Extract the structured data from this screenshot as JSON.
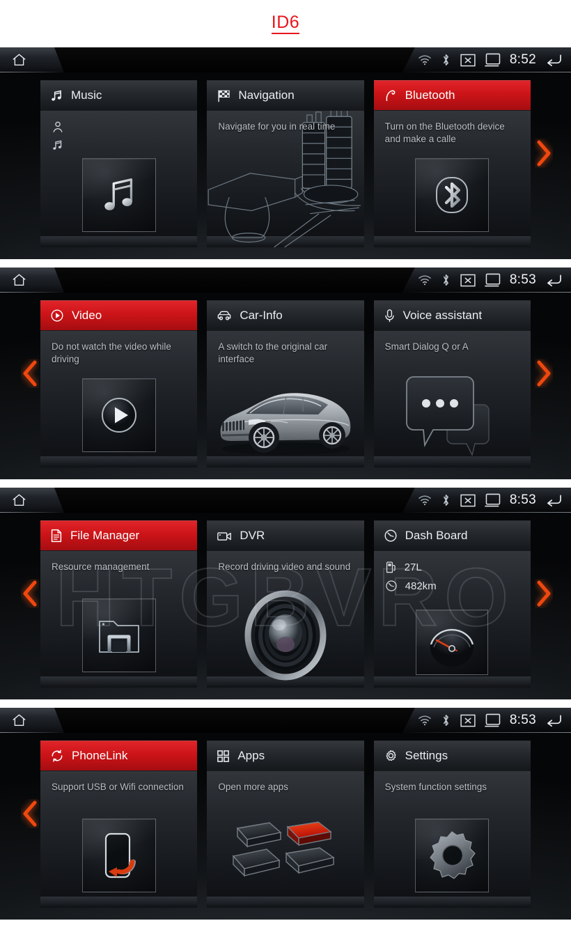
{
  "page": {
    "title": "ID6",
    "title_color": "#e8151c",
    "accent_red": "#cc1418",
    "arrow_color": "#f04a12",
    "watermark": "HTGBVRO"
  },
  "statusbar": {
    "home_icon": "home-icon",
    "icons": [
      "wifi-icon",
      "bluetooth-icon",
      "screen-off-icon",
      "display-icon"
    ],
    "back_icon": "back-arrow-icon"
  },
  "panels": [
    {
      "name": "panel-1",
      "time": "8:52",
      "nav_left": false,
      "nav_right": true,
      "cards": [
        {
          "title": "Music",
          "icon": "music-note-icon",
          "active": false,
          "subtitle": "",
          "art": "music-note-tile",
          "mini_icons": [
            "person-icon",
            "music-note-icon"
          ]
        },
        {
          "title": "Navigation",
          "icon": "checkered-flag-icon",
          "active": false,
          "subtitle": "Navigate for you in real time",
          "art": "city-map-illustration",
          "mini_icons": []
        },
        {
          "title": "Bluetooth",
          "icon": "phone-handset-icon",
          "active": true,
          "subtitle": "Turn on the Bluetooth device and make a calle",
          "art": "bluetooth-tile",
          "mini_icons": []
        }
      ]
    },
    {
      "name": "panel-2",
      "time": "8:53",
      "nav_left": true,
      "nav_right": true,
      "cards": [
        {
          "title": "Video",
          "icon": "play-circle-icon",
          "active": true,
          "subtitle": "Do not watch the video while driving",
          "art": "play-tile",
          "mini_icons": []
        },
        {
          "title": "Car-Info",
          "icon": "car-icon",
          "active": false,
          "subtitle": "A switch to the original car interface",
          "art": "car-illustration",
          "mini_icons": []
        },
        {
          "title": "Voice assistant",
          "icon": "microphone-icon",
          "active": false,
          "subtitle": "Smart Dialog Q or A",
          "art": "speech-bubbles-illustration",
          "mini_icons": []
        }
      ]
    },
    {
      "name": "panel-3",
      "time": "8:53",
      "nav_left": true,
      "nav_right": true,
      "cards": [
        {
          "title": "File Manager",
          "icon": "document-icon",
          "active": true,
          "subtitle": "Resource management",
          "art": "folder-tile",
          "mini_icons": []
        },
        {
          "title": "DVR",
          "icon": "video-camera-icon",
          "active": false,
          "subtitle": "Record driving video and sound",
          "art": "camera-lens-illustration",
          "mini_icons": []
        },
        {
          "title": "Dash Board",
          "icon": "gauge-icon",
          "active": false,
          "subtitle": "",
          "art": "speedometer-tile",
          "metrics": [
            {
              "icon": "fuel-pump-icon",
              "value": "27L"
            },
            {
              "icon": "gauge-icon",
              "value": "482km"
            }
          ],
          "mini_icons": []
        }
      ]
    },
    {
      "name": "panel-4",
      "time": "8:53",
      "nav_left": true,
      "nav_right": false,
      "cards": [
        {
          "title": "PhoneLink",
          "icon": "sync-arrows-icon",
          "active": true,
          "subtitle": "Support USB or Wifi connection",
          "art": "phone-sync-tile",
          "mini_icons": []
        },
        {
          "title": "Apps",
          "icon": "grid-four-icon",
          "active": false,
          "subtitle": "Open more apps",
          "art": "app-tiles-illustration",
          "mini_icons": []
        },
        {
          "title": "Settings",
          "icon": "gear-icon",
          "active": false,
          "subtitle": "System function settings",
          "art": "gear-tile",
          "mini_icons": []
        }
      ]
    }
  ]
}
